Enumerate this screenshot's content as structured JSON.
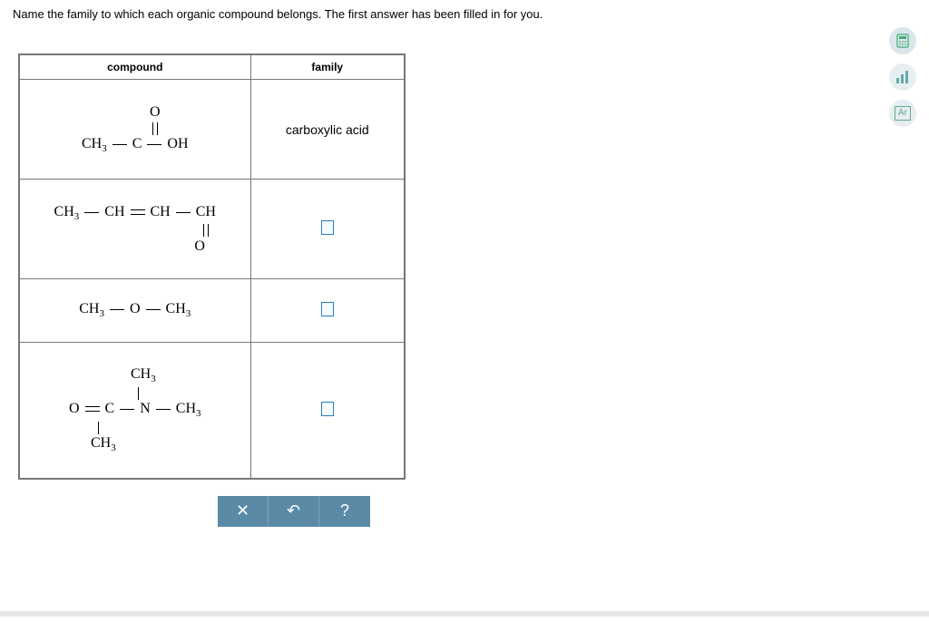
{
  "prompt": "Name the family to which each organic compound belongs. The first answer has been filled in for you.",
  "table": {
    "header_compound": "compound",
    "header_family": "family",
    "rows": [
      {
        "family": "carboxylic acid"
      },
      {
        "family": ""
      },
      {
        "family": ""
      },
      {
        "family": ""
      }
    ]
  },
  "formulas": {
    "r1": {
      "O": "O",
      "CH3": "CH",
      "sub3": "3",
      "C": "C",
      "OH": "OH"
    },
    "r2": {
      "CH3": "CH",
      "sub3": "3",
      "CH": "CH",
      "O": "O"
    },
    "r3": {
      "CH3a": "CH",
      "sub3": "3",
      "O": "O",
      "CH3b": "CH"
    },
    "r4": {
      "O": "O",
      "C": "C",
      "N": "N",
      "CH3": "CH",
      "sub3": "3"
    }
  },
  "toolbar": {
    "clear": "✕",
    "undo": "↶",
    "help": "?"
  },
  "side": {
    "calc": "",
    "graph": "",
    "periodic": "Ar"
  }
}
